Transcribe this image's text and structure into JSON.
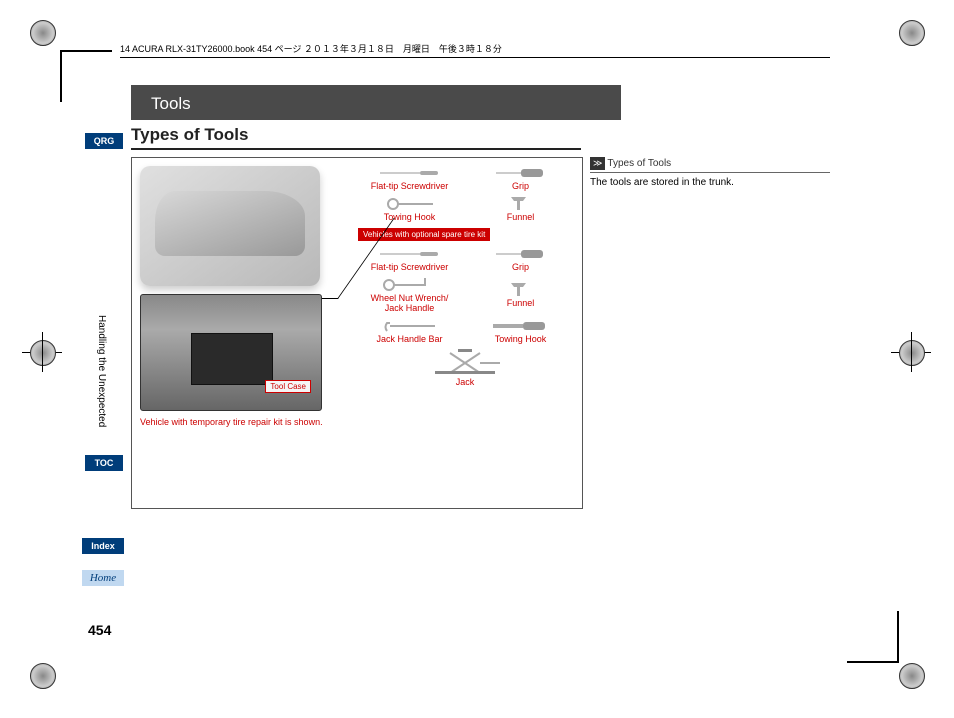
{
  "file_header": "14 ACURA RLX-31TY26000.book  454 ページ  ２０１３年３月１８日　月曜日　午後３時１８分",
  "title_bar": "Tools",
  "section_title": "Types of Tools",
  "nav": {
    "qrg": "QRG",
    "toc": "TOC",
    "index": "Index",
    "home": "Home"
  },
  "vertical_label": "Handling the Unexpected",
  "page_number": "454",
  "diagram": {
    "tool_case": "Tool Case",
    "caption": "Vehicle with temporary tire repair kit is shown.",
    "spare_kit_label": "Vehicles with optional spare tire kit",
    "tools_top": {
      "flat_tip": "Flat-tip Screwdriver",
      "grip": "Grip",
      "towing_hook": "Towing Hook",
      "funnel": "Funnel"
    },
    "tools_bottom": {
      "flat_tip": "Flat-tip Screwdriver",
      "grip": "Grip",
      "wheel_nut": "Wheel Nut Wrench/\nJack Handle",
      "funnel": "Funnel",
      "jack_handle_bar": "Jack Handle Bar",
      "towing_hook": "Towing Hook",
      "jack": "Jack"
    }
  },
  "side_note": {
    "header": "≫",
    "title": "Types of Tools",
    "body": "The tools are stored in the trunk."
  }
}
